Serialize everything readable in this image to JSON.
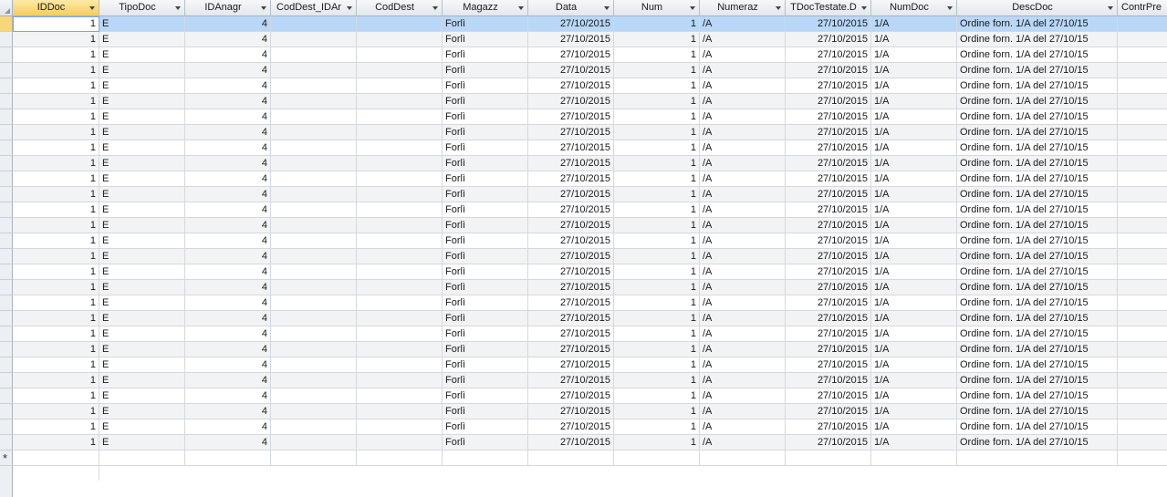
{
  "columns": [
    {
      "label": "IDDoc",
      "has_dropdown": true
    },
    {
      "label": "TipoDoc",
      "has_dropdown": true
    },
    {
      "label": "IDAnagr",
      "has_dropdown": true
    },
    {
      "label": "CodDest_IDAr",
      "has_dropdown": true
    },
    {
      "label": "CodDest",
      "has_dropdown": true
    },
    {
      "label": "Magazz",
      "has_dropdown": true
    },
    {
      "label": "Data",
      "has_dropdown": true
    },
    {
      "label": "Num",
      "has_dropdown": true
    },
    {
      "label": "Numeraz",
      "has_dropdown": true
    },
    {
      "label": "TDocTestate.D",
      "has_dropdown": true
    },
    {
      "label": "NumDoc",
      "has_dropdown": true
    },
    {
      "label": "DescDoc",
      "has_dropdown": true
    },
    {
      "label": "ContrPre",
      "has_dropdown": false
    }
  ],
  "rows": [
    [
      "1",
      "E",
      "4",
      "",
      "",
      "Forlì",
      "27/10/2015",
      "1",
      "/A",
      "27/10/2015",
      "1/A",
      "Ordine forn. 1/A del 27/10/15",
      ""
    ],
    [
      "1",
      "E",
      "4",
      "",
      "",
      "Forlì",
      "27/10/2015",
      "1",
      "/A",
      "27/10/2015",
      "1/A",
      "Ordine forn. 1/A del 27/10/15",
      ""
    ],
    [
      "1",
      "E",
      "4",
      "",
      "",
      "Forlì",
      "27/10/2015",
      "1",
      "/A",
      "27/10/2015",
      "1/A",
      "Ordine forn. 1/A del 27/10/15",
      ""
    ],
    [
      "1",
      "E",
      "4",
      "",
      "",
      "Forlì",
      "27/10/2015",
      "1",
      "/A",
      "27/10/2015",
      "1/A",
      "Ordine forn. 1/A del 27/10/15",
      ""
    ],
    [
      "1",
      "E",
      "4",
      "",
      "",
      "Forlì",
      "27/10/2015",
      "1",
      "/A",
      "27/10/2015",
      "1/A",
      "Ordine forn. 1/A del 27/10/15",
      ""
    ],
    [
      "1",
      "E",
      "4",
      "",
      "",
      "Forlì",
      "27/10/2015",
      "1",
      "/A",
      "27/10/2015",
      "1/A",
      "Ordine forn. 1/A del 27/10/15",
      ""
    ],
    [
      "1",
      "E",
      "4",
      "",
      "",
      "Forlì",
      "27/10/2015",
      "1",
      "/A",
      "27/10/2015",
      "1/A",
      "Ordine forn. 1/A del 27/10/15",
      ""
    ],
    [
      "1",
      "E",
      "4",
      "",
      "",
      "Forlì",
      "27/10/2015",
      "1",
      "/A",
      "27/10/2015",
      "1/A",
      "Ordine forn. 1/A del 27/10/15",
      ""
    ],
    [
      "1",
      "E",
      "4",
      "",
      "",
      "Forlì",
      "27/10/2015",
      "1",
      "/A",
      "27/10/2015",
      "1/A",
      "Ordine forn. 1/A del 27/10/15",
      ""
    ],
    [
      "1",
      "E",
      "4",
      "",
      "",
      "Forlì",
      "27/10/2015",
      "1",
      "/A",
      "27/10/2015",
      "1/A",
      "Ordine forn. 1/A del 27/10/15",
      ""
    ],
    [
      "1",
      "E",
      "4",
      "",
      "",
      "Forlì",
      "27/10/2015",
      "1",
      "/A",
      "27/10/2015",
      "1/A",
      "Ordine forn. 1/A del 27/10/15",
      ""
    ],
    [
      "1",
      "E",
      "4",
      "",
      "",
      "Forlì",
      "27/10/2015",
      "1",
      "/A",
      "27/10/2015",
      "1/A",
      "Ordine forn. 1/A del 27/10/15",
      ""
    ],
    [
      "1",
      "E",
      "4",
      "",
      "",
      "Forlì",
      "27/10/2015",
      "1",
      "/A",
      "27/10/2015",
      "1/A",
      "Ordine forn. 1/A del 27/10/15",
      ""
    ],
    [
      "1",
      "E",
      "4",
      "",
      "",
      "Forlì",
      "27/10/2015",
      "1",
      "/A",
      "27/10/2015",
      "1/A",
      "Ordine forn. 1/A del 27/10/15",
      ""
    ],
    [
      "1",
      "E",
      "4",
      "",
      "",
      "Forlì",
      "27/10/2015",
      "1",
      "/A",
      "27/10/2015",
      "1/A",
      "Ordine forn. 1/A del 27/10/15",
      ""
    ],
    [
      "1",
      "E",
      "4",
      "",
      "",
      "Forlì",
      "27/10/2015",
      "1",
      "/A",
      "27/10/2015",
      "1/A",
      "Ordine forn. 1/A del 27/10/15",
      ""
    ],
    [
      "1",
      "E",
      "4",
      "",
      "",
      "Forlì",
      "27/10/2015",
      "1",
      "/A",
      "27/10/2015",
      "1/A",
      "Ordine forn. 1/A del 27/10/15",
      ""
    ],
    [
      "1",
      "E",
      "4",
      "",
      "",
      "Forlì",
      "27/10/2015",
      "1",
      "/A",
      "27/10/2015",
      "1/A",
      "Ordine forn. 1/A del 27/10/15",
      ""
    ],
    [
      "1",
      "E",
      "4",
      "",
      "",
      "Forlì",
      "27/10/2015",
      "1",
      "/A",
      "27/10/2015",
      "1/A",
      "Ordine forn. 1/A del 27/10/15",
      ""
    ],
    [
      "1",
      "E",
      "4",
      "",
      "",
      "Forlì",
      "27/10/2015",
      "1",
      "/A",
      "27/10/2015",
      "1/A",
      "Ordine forn. 1/A del 27/10/15",
      ""
    ],
    [
      "1",
      "E",
      "4",
      "",
      "",
      "Forlì",
      "27/10/2015",
      "1",
      "/A",
      "27/10/2015",
      "1/A",
      "Ordine forn. 1/A del 27/10/15",
      ""
    ],
    [
      "1",
      "E",
      "4",
      "",
      "",
      "Forlì",
      "27/10/2015",
      "1",
      "/A",
      "27/10/2015",
      "1/A",
      "Ordine forn. 1/A del 27/10/15",
      ""
    ],
    [
      "1",
      "E",
      "4",
      "",
      "",
      "Forlì",
      "27/10/2015",
      "1",
      "/A",
      "27/10/2015",
      "1/A",
      "Ordine forn. 1/A del 27/10/15",
      ""
    ],
    [
      "1",
      "E",
      "4",
      "",
      "",
      "Forlì",
      "27/10/2015",
      "1",
      "/A",
      "27/10/2015",
      "1/A",
      "Ordine forn. 1/A del 27/10/15",
      ""
    ],
    [
      "1",
      "E",
      "4",
      "",
      "",
      "Forlì",
      "27/10/2015",
      "1",
      "/A",
      "27/10/2015",
      "1/A",
      "Ordine forn. 1/A del 27/10/15",
      ""
    ],
    [
      "1",
      "E",
      "4",
      "",
      "",
      "Forlì",
      "27/10/2015",
      "1",
      "/A",
      "27/10/2015",
      "1/A",
      "Ordine forn. 1/A del 27/10/15",
      ""
    ],
    [
      "1",
      "E",
      "4",
      "",
      "",
      "Forlì",
      "27/10/2015",
      "1",
      "/A",
      "27/10/2015",
      "1/A",
      "Ordine forn. 1/A del 27/10/15",
      ""
    ],
    [
      "1",
      "E",
      "4",
      "",
      "",
      "Forlì",
      "27/10/2015",
      "1",
      "/A",
      "27/10/2015",
      "1/A",
      "Ordine forn. 1/A del 27/10/15",
      ""
    ]
  ],
  "new_record_marker": "*",
  "colors": {
    "selected_row": "#b9d7f7",
    "active_header": "#f6cd5c",
    "alt_row": "#f2f3f5"
  }
}
